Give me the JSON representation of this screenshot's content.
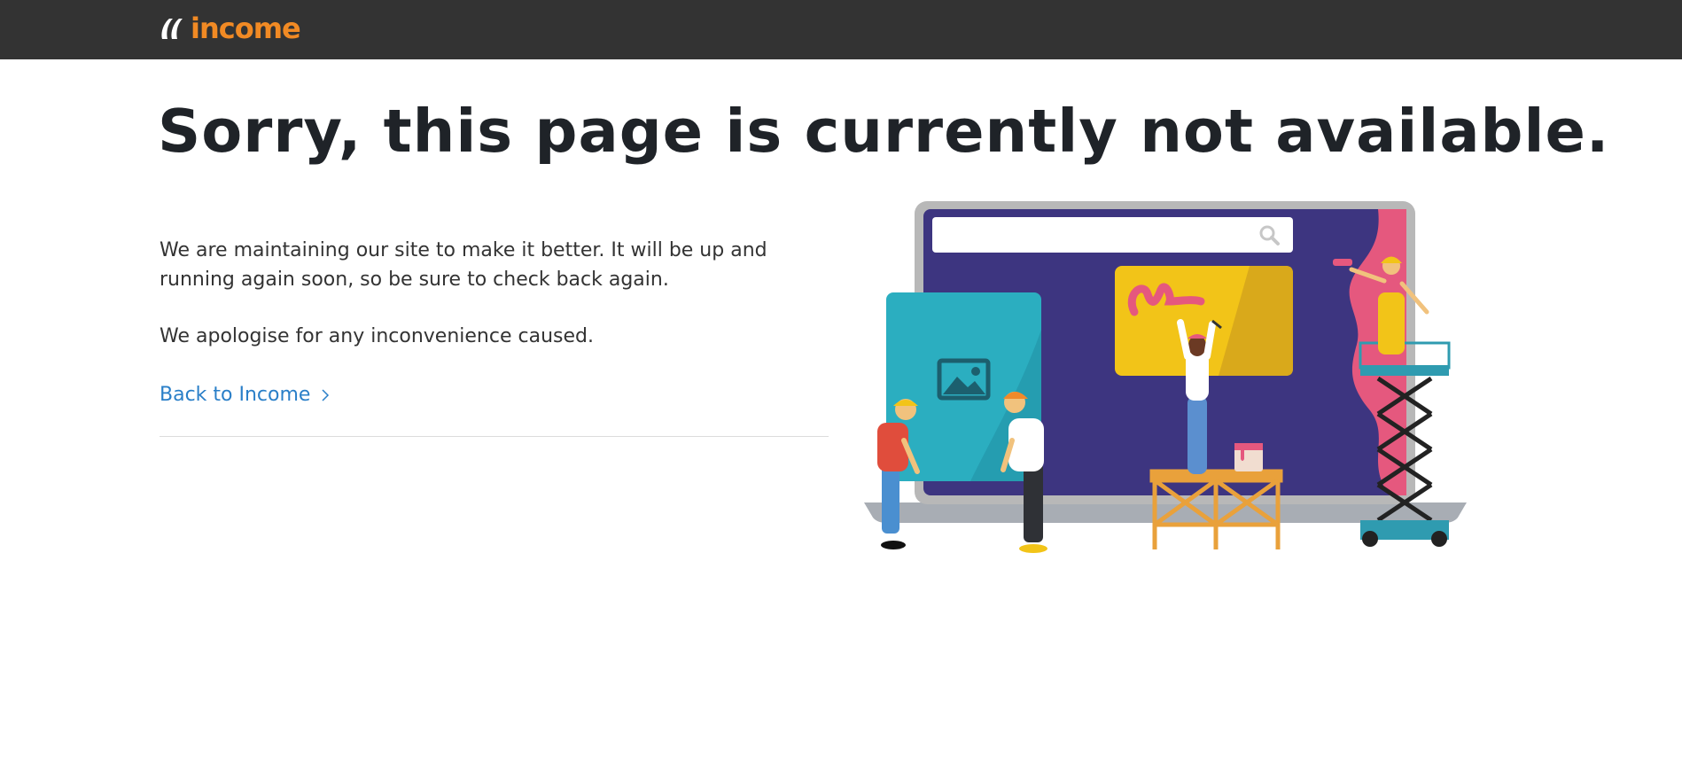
{
  "header": {
    "brand": "income",
    "brand_color": "#f18a24",
    "background_color": "#333333"
  },
  "main": {
    "headline": "Sorry, this page is currently not available.",
    "paragraphs": [
      "We are maintaining our site to make it better. It will be up and running again soon, so be sure to check back again.",
      "We apologise for any inconvenience caused."
    ],
    "back_link": {
      "label": "Back to Income",
      "icon": "chevron-right-icon",
      "color": "#2a7fc8"
    }
  },
  "illustration": {
    "description_icon": "maintenance-illustration",
    "colors": {
      "screen": "#3d3580",
      "frame": "#b3b3b3",
      "teal_panel": "#2baec0",
      "yellow_panel": "#f2c418",
      "pink": "#e5587e",
      "scaffold": "#e9a13b",
      "lift": "#2f9bb0"
    }
  }
}
